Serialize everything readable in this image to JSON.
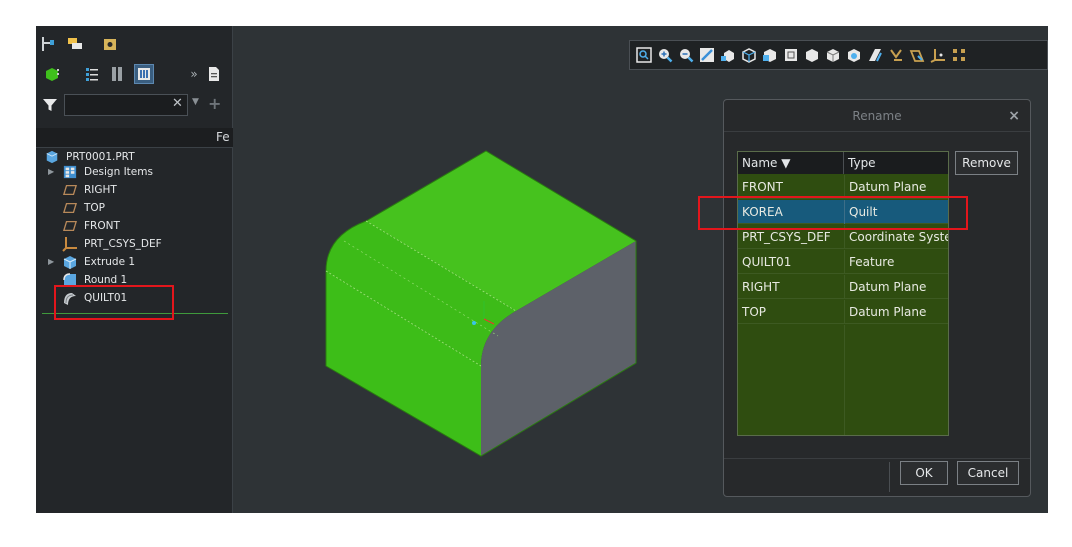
{
  "model_tree": {
    "column_header": "Fe",
    "filter": {
      "value": "",
      "placeholder": ""
    },
    "root": {
      "label": "PRT0001.PRT",
      "icon": "part-icon"
    },
    "items": [
      {
        "label": "Design Items",
        "icon": "design-items-icon",
        "expandable": true
      },
      {
        "label": "RIGHT",
        "icon": "datum-plane-icon",
        "expandable": false
      },
      {
        "label": "TOP",
        "icon": "datum-plane-icon",
        "expandable": false
      },
      {
        "label": "FRONT",
        "icon": "datum-plane-icon",
        "expandable": false
      },
      {
        "label": "PRT_CSYS_DEF",
        "icon": "coordinate-system-icon",
        "expandable": false
      },
      {
        "label": "Extrude 1",
        "icon": "extrude-icon",
        "expandable": true
      },
      {
        "label": "Round 1",
        "icon": "round-icon",
        "expandable": false
      },
      {
        "label": "QUILT01",
        "icon": "quilt-icon",
        "expandable": false
      }
    ]
  },
  "rename_dialog": {
    "title": "Rename",
    "close_icon": "close-icon",
    "columns": {
      "name": "Name ▼",
      "type": "Type"
    },
    "rows": [
      {
        "name": "FRONT",
        "type": "Datum Plane",
        "selected": false
      },
      {
        "name": "KOREA",
        "type": "Quilt",
        "selected": true
      },
      {
        "name": "PRT_CSYS_DEF",
        "type": "Coordinate System",
        "selected": false
      },
      {
        "name": "QUILT01",
        "type": "Feature",
        "selected": false
      },
      {
        "name": "RIGHT",
        "type": "Datum Plane",
        "selected": false
      },
      {
        "name": "TOP",
        "type": "Datum Plane",
        "selected": false
      }
    ],
    "remove_label": "Remove",
    "ok_label": "OK",
    "cancel_label": "Cancel"
  },
  "colors": {
    "viewport_bg": "#2e3336",
    "model_green": "#3fbf1c",
    "model_side": "#5b5f68",
    "selection_blue": "#175a7c",
    "table_green": "#2f4d10",
    "highlight_red": "#e3161c"
  },
  "view_toolbar_icons": [
    "refit-icon",
    "zoom-in-icon",
    "zoom-out-icon",
    "repaint-icon",
    "saved-views-icon",
    "display-style-icon",
    "view-manager-icon",
    "perspective-icon",
    "datum-display-icon",
    "annotation-display-icon",
    "spin-center-icon",
    "plane-display-icon",
    "axis-display-icon",
    "point-display-icon",
    "csys-display-icon",
    "more-icon"
  ]
}
